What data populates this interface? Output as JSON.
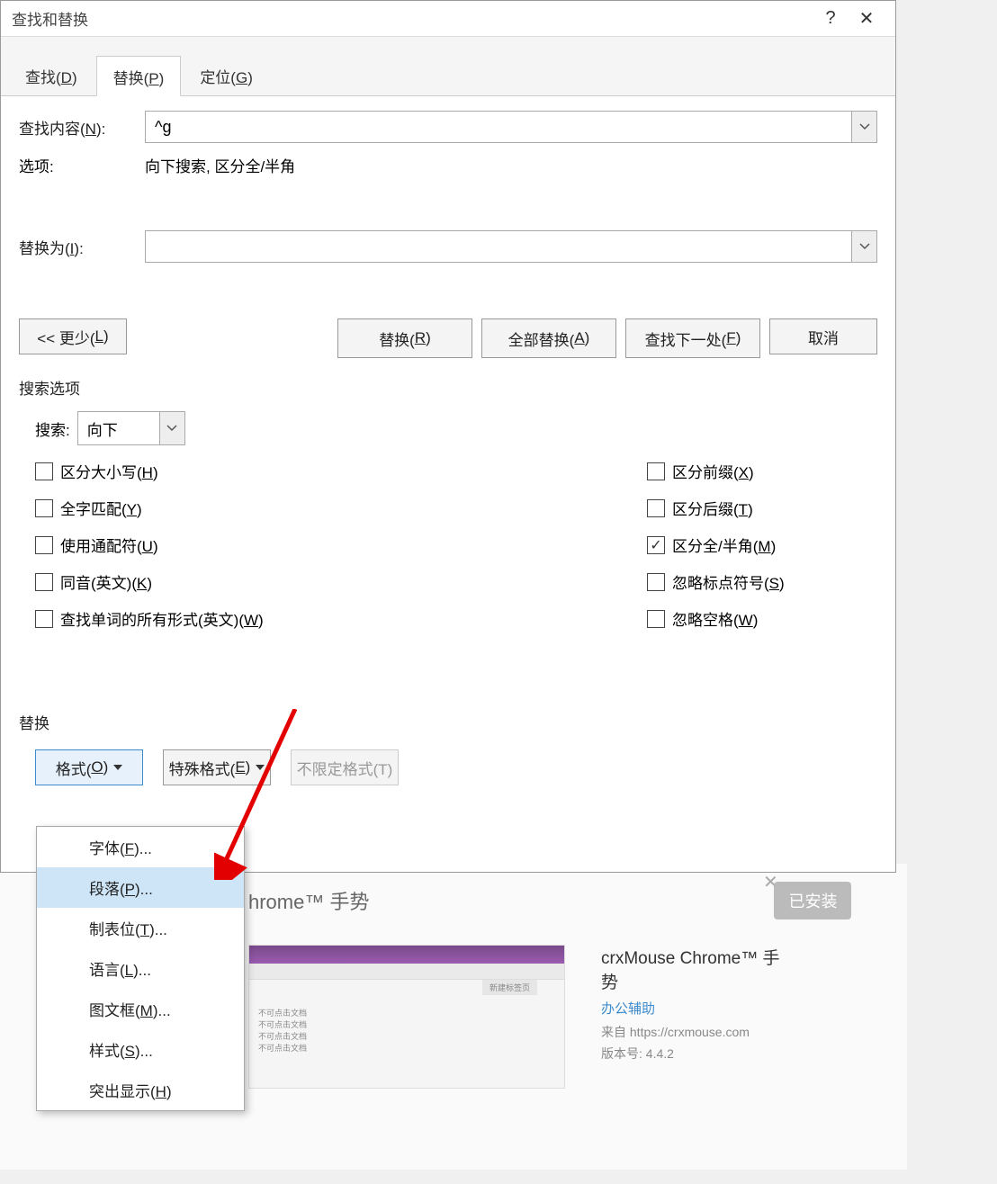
{
  "dialog": {
    "title": "查找和替换",
    "help": "?",
    "close": "✕"
  },
  "tabs": {
    "find": "查找(D)",
    "replace": "替换(P)",
    "goto": "定位(G)"
  },
  "fields": {
    "find_label": "查找内容(N):",
    "find_value": "^g",
    "options_label": "选项:",
    "options_value": "向下搜索, 区分全/半角",
    "replace_label": "替换为(I):",
    "replace_value": ""
  },
  "buttons": {
    "less": "<< 更少(L)",
    "replace": "替换(R)",
    "replace_all": "全部替换(A)",
    "find_next": "查找下一处(F)",
    "cancel": "取消"
  },
  "search_opts": {
    "title": "搜索选项",
    "search_label": "搜索:",
    "search_value": "向下",
    "left": {
      "match_case": "区分大小写(H)",
      "whole_word": "全字匹配(Y)",
      "wildcards": "使用通配符(U)",
      "sounds_like": "同音(英文)(K)",
      "word_forms": "查找单词的所有形式(英文)(W)"
    },
    "right": {
      "prefix": "区分前缀(X)",
      "suffix": "区分后缀(T)",
      "fullhalf": "区分全/半角(M)",
      "punct": "忽略标点符号(S)",
      "space": "忽略空格(W)"
    }
  },
  "replace_section": {
    "title": "替换",
    "format": "格式(O)",
    "special": "特殊格式(E)",
    "no_format": "不限定格式(T)"
  },
  "menu": {
    "font": "字体(F)...",
    "paragraph": "段落(P)...",
    "tabs": "制表位(T)...",
    "language": "语言(L)...",
    "frame": "图文框(M)...",
    "style": "样式(S)...",
    "highlight": "突出显示(H)"
  },
  "bg": {
    "ext_title_partial": "hrome™ 手势",
    "installed": "已安装",
    "full_title": "crxMouse Chrome™ 手势",
    "category": "办公辅助",
    "source": "来自 https://crxmouse.com",
    "version": "版本号: 4.4.2",
    "thumb_tag": "新建标签页"
  }
}
